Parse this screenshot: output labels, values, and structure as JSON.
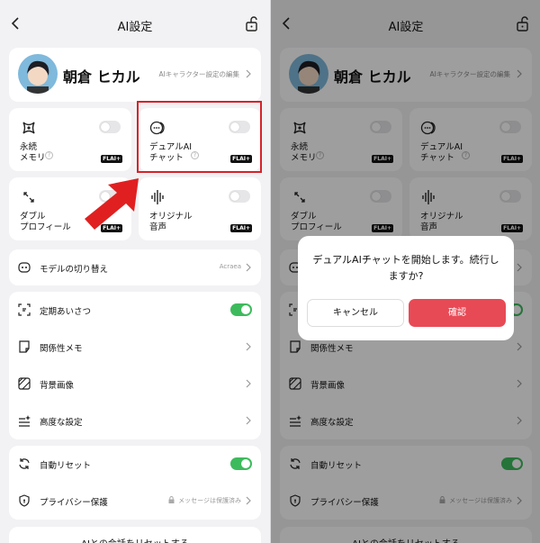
{
  "header": {
    "title": "AI設定"
  },
  "profile": {
    "name": "朝倉 ヒカル",
    "edit_label": "AIキャラクター設定の編集"
  },
  "tiles": [
    {
      "label": "永続\nメモリ",
      "badge": "FLAI+",
      "icon": "memory-icon"
    },
    {
      "label": "デュアルAI\nチャット",
      "badge": "FLAI+",
      "icon": "chat-bubbles-icon"
    },
    {
      "label": "ダブル\nプロフィール",
      "badge": "FLAI+",
      "icon": "swap-icon"
    },
    {
      "label": "オリジナル\n音声",
      "badge": "FLAI+",
      "icon": "voice-wave-icon"
    }
  ],
  "model_switch": {
    "label": "モデルの切り替え",
    "value": "Acraea"
  },
  "settings_rows": [
    {
      "label": "定期あいさつ",
      "toggle": true
    },
    {
      "label": "関係性メモ"
    },
    {
      "label": "背景画像"
    },
    {
      "label": "高度な設定"
    }
  ],
  "reset_rows": [
    {
      "label": "自動リセット",
      "toggle": true
    },
    {
      "label": "プライバシー保護",
      "value": "メッセージは保護済み"
    }
  ],
  "bottom_button": "AIとの会話をリセットする",
  "dialog": {
    "message": "デュアルAIチャットを開始します。続行しますか?",
    "cancel": "キャンセル",
    "confirm": "確認"
  },
  "colors": {
    "toggle_on": "#3dbb5c",
    "confirm": "#e84a55",
    "highlight": "#d7222a",
    "arrow": "#e02020"
  }
}
